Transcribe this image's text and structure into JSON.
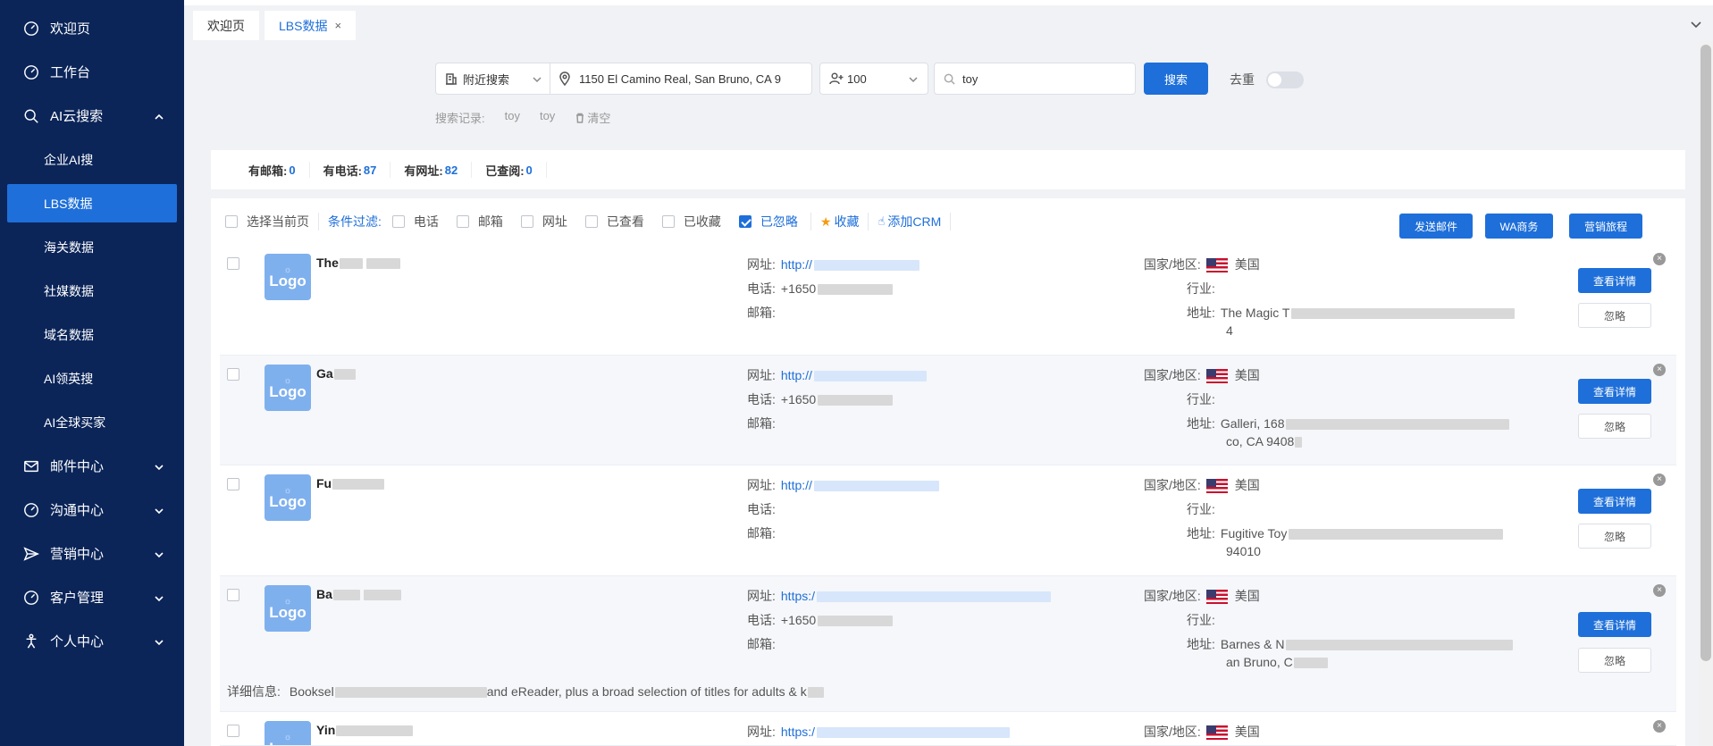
{
  "sidebar": {
    "items": [
      {
        "label": "欢迎页",
        "icon": "dashboard-icon"
      },
      {
        "label": "工作台",
        "icon": "dashboard-icon"
      },
      {
        "label": "AI云搜索",
        "icon": "search-icon",
        "expanded": true
      },
      {
        "label": "邮件中心",
        "icon": "mail-icon"
      },
      {
        "label": "沟通中心",
        "icon": "dashboard-icon"
      },
      {
        "label": "营销中心",
        "icon": "send-icon"
      },
      {
        "label": "客户管理",
        "icon": "dashboard-icon"
      },
      {
        "label": "个人中心",
        "icon": "person-icon"
      }
    ],
    "sub_items": [
      "企业AI搜",
      "LBS数据",
      "海关数据",
      "社媒数据",
      "域名数据",
      "AI领英搜",
      "AI全球买家"
    ],
    "active_sub": "LBS数据"
  },
  "tabs": [
    {
      "label": "欢迎页",
      "active": false
    },
    {
      "label": "LBS数据",
      "active": true,
      "closable": "×"
    }
  ],
  "search": {
    "mode": "附近搜索",
    "address": "1150 El Camino Real, San Bruno, CA 9",
    "count": "100",
    "keyword": "toy",
    "search_button": "搜索",
    "dedup_label": "去重",
    "dedup_on": false,
    "history_label": "搜索记录:",
    "history": [
      "toy",
      "toy"
    ],
    "clear_label": "清空"
  },
  "stats": [
    {
      "label": "有邮箱:",
      "value": "0"
    },
    {
      "label": "有电话:",
      "value": "87"
    },
    {
      "label": "有网址:",
      "value": "82"
    },
    {
      "label": "已查阅:",
      "value": "0"
    }
  ],
  "filters": {
    "select_page": "选择当前页",
    "filter_label": "条件过滤:",
    "options": [
      {
        "label": "电话",
        "checked": false
      },
      {
        "label": "邮箱",
        "checked": false
      },
      {
        "label": "网址",
        "checked": false
      },
      {
        "label": "已查看",
        "checked": false
      },
      {
        "label": "已收藏",
        "checked": false
      },
      {
        "label": "已忽略",
        "checked": true
      }
    ],
    "favorite": "收藏",
    "add_crm": "添加CRM",
    "send_email": "发送邮件",
    "wa": "WA商务",
    "marketing": "营销旅程"
  },
  "labels": {
    "website": "网址:",
    "phone": "电话:",
    "email": "邮箱:",
    "country": "国家/地区:",
    "industry": "行业:",
    "address": "地址:",
    "detail": "详细信息:",
    "view_detail": "查看详情",
    "ignore": "忽略",
    "logo": "Logo"
  },
  "rows": [
    {
      "name": "The",
      "website": "http://",
      "phone": "+1650",
      "country": "美国",
      "address": "The Magic T",
      "address2": "4"
    },
    {
      "name": "Ga",
      "website": "http://",
      "phone": "+1650",
      "country": "美国",
      "address": "Galleri, 168",
      "address2": "co, CA 9408"
    },
    {
      "name": "Fu",
      "website": "http://",
      "phone": "",
      "country": "美国",
      "address": "Fugitive Toy",
      "address2": "94010"
    },
    {
      "name": "Ba",
      "website": "https:/",
      "phone": "+1650",
      "country": "美国",
      "address": "Barnes & N",
      "address2": "an Bruno, C",
      "detail_a": "Booksel",
      "detail_b": "and eReader, plus a broad selection of titles for adults & k"
    },
    {
      "name": "Yin",
      "website": "https:/",
      "phone": "",
      "country": "美国",
      "address": "",
      "address2": ""
    }
  ]
}
